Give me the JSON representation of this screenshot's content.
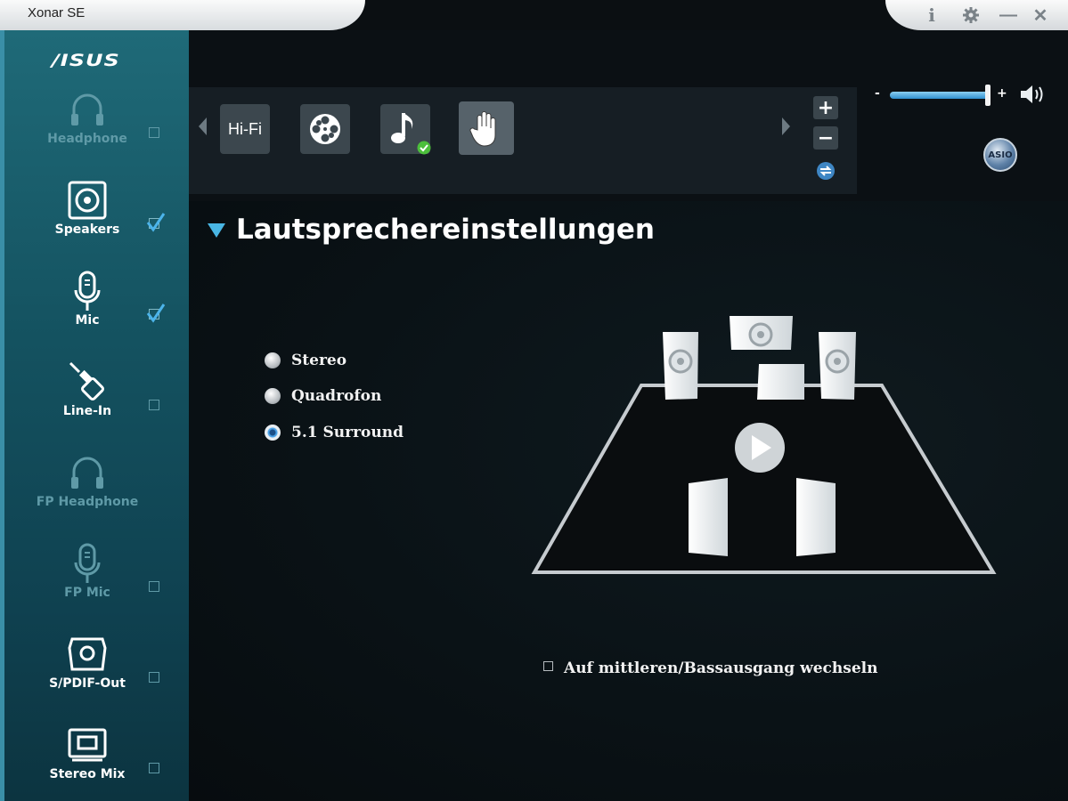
{
  "window": {
    "title": "Xonar SE",
    "controls": [
      "i",
      "⚙",
      "—",
      "✕"
    ]
  },
  "sidebar": {
    "logo": "/ISUS",
    "devices": [
      {
        "label": "Headphone",
        "enabled": false,
        "checked": false,
        "icon": "headphone-icon"
      },
      {
        "label": "Speakers",
        "enabled": true,
        "checked": true,
        "icon": "speaker-icon"
      },
      {
        "label": "Mic",
        "enabled": true,
        "checked": true,
        "icon": "mic-icon"
      },
      {
        "label": "Line-In",
        "enabled": true,
        "checked": false,
        "icon": "line-in-icon"
      },
      {
        "label": "FP Headphone",
        "enabled": false,
        "checked": false,
        "icon": "headphone-icon"
      },
      {
        "label": "FP Mic",
        "enabled": false,
        "checked": false,
        "icon": "mic-icon"
      },
      {
        "label": "S/PDIF-Out",
        "enabled": true,
        "checked": false,
        "icon": "spdif-icon"
      },
      {
        "label": "Stereo Mix",
        "enabled": true,
        "checked": false,
        "icon": "stereo-mix-icon"
      }
    ]
  },
  "presets": {
    "items": [
      {
        "label": "Hi-Fi",
        "icon": "hifi-icon"
      },
      {
        "label": "",
        "icon": "film-reel-icon"
      },
      {
        "label": "",
        "icon": "music-note-icon",
        "badge": "check-badge-icon"
      },
      {
        "label": "",
        "icon": "hand-icon",
        "active": true
      }
    ],
    "add_label": "+",
    "remove_label": "−"
  },
  "volume": {
    "minus_label": "-",
    "plus_label": "+",
    "level": 0.97
  },
  "asio_label": "ASIO",
  "main": {
    "section_title": "Lautsprechereinstellungen",
    "speaker_modes": [
      {
        "label": "Stereo",
        "selected": false
      },
      {
        "label": "Quadrofon",
        "selected": false
      },
      {
        "label": "5.1 Surround",
        "selected": true
      }
    ],
    "swap_checkbox_label": "Auf mittleren/Bassausgang wechseln",
    "swap_checked": false
  },
  "colors": {
    "accent": "#49b6e4",
    "sidebar": "#145260",
    "background": "#0a1216"
  }
}
